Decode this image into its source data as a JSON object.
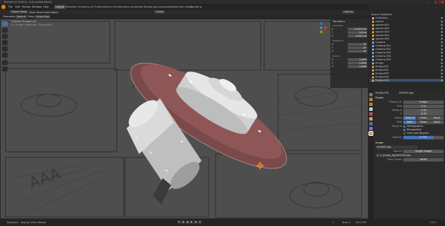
{
  "app": {
    "title": "Blender [C:\\Users\\...\\ufo_scene.blend]"
  },
  "window_controls": [
    "–",
    "□",
    "✕"
  ],
  "menus": [
    "File",
    "Edit",
    "Render",
    "Window",
    "Help"
  ],
  "workspaces": [
    "Layout",
    "Modeling",
    "Sculpting",
    "UV Editing",
    "Texture Paint",
    "Shading",
    "Animation",
    "Rendering",
    "Compositing",
    "Geometry Nodes",
    "Scripting"
  ],
  "scene": {
    "scene_label": "Scene",
    "view_layer_label": "ViewLayer"
  },
  "header": {
    "mode": "Object Mode",
    "view": "View",
    "select": "Select",
    "add": "Add",
    "object": "Object",
    "global": "Global",
    "orientation_label": "Orientation:",
    "orientation_value": "Default",
    "drag_label": "Drag:",
    "drag_value": "Select Box",
    "options": "Options"
  },
  "viewport": {
    "line1": "Camera Perspective",
    "line2": "(1) Scene Collection | Empty.005",
    "camera_label": "Camera"
  },
  "npanel": {
    "section": "Transform",
    "location_label": "Location:",
    "rows": [
      {
        "label": "X",
        "value": "-1.4571 m"
      },
      {
        "label": "Y",
        "value": "-3.4 m"
      },
      {
        "label": "Z",
        "value": "5.411 m"
      }
    ],
    "rotation_label": "Rotation:",
    "rot_rows": [
      {
        "label": "X",
        "value": "0°"
      },
      {
        "label": "Y",
        "value": "0°"
      },
      {
        "label": "Z",
        "value": "0°"
      }
    ],
    "scale_label": "Scale:",
    "scale_rows": [
      {
        "label": "X",
        "value": "1.000"
      },
      {
        "label": "Y",
        "value": "1.000"
      },
      {
        "label": "Z",
        "value": "1.000"
      }
    ]
  },
  "outliner": {
    "root": "Scene Collection",
    "items": [
      "Collection",
      "saucer",
      "saucer.001",
      "saucer.002",
      "saucer.003",
      "saucer.004",
      "saucer.005",
      "Camera",
      "Camera.001",
      "Camera.002",
      "Camera.003",
      "Camera.004",
      "Camera.005",
      "Empty",
      "Empty.001",
      "Empty.002",
      "Empty.003",
      "Empty.004",
      "Empty.005"
    ]
  },
  "properties": {
    "object_name": "Empty.005",
    "data_name": "000005.jpg",
    "section_empty": "Empty",
    "display_as_label": "Display As",
    "display_as_value": "Image",
    "size_label": "Size",
    "size_value": "5 m",
    "offset_x_label": "Offset X",
    "offset_x_value": "-0.50",
    "offset_y_label": "Y",
    "offset_y_value": "-0.50",
    "depth_label": "Depth",
    "depth_options": [
      "Default",
      "Front",
      "Back"
    ],
    "side_label": "Side",
    "side_options": [
      "Both",
      "Front",
      "Back"
    ],
    "show_in_label": "Show In",
    "show_orthographic": "Orthographic",
    "show_perspective": "Perspective",
    "show_axis": "Only Axis Aligned",
    "opacity_label": "Opacity",
    "opacity_value": "0.750",
    "section_image": "Image",
    "image_name": "000005.jpg",
    "source_label": "Source",
    "source_value": "Single Image",
    "filepath": "//..\\..\\comic_bg\\000005.jpg",
    "colorspace_label": "Color Space",
    "colorspace_value": "sRGB"
  },
  "status": {
    "playback": "Playback",
    "keying": "Keying",
    "view": "View",
    "marker": "Marker",
    "frame": "1",
    "start_label": "Start",
    "start": "1",
    "end_label": "End",
    "end": "250",
    "version": "3.3.1"
  }
}
